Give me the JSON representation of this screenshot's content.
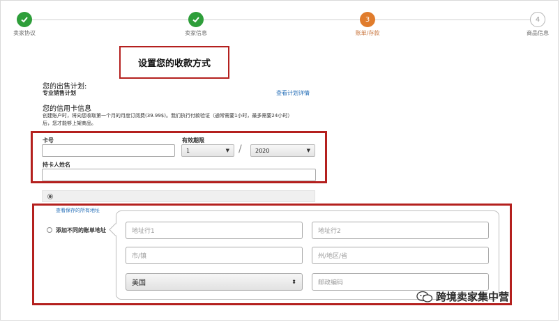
{
  "stepper": {
    "steps": [
      {
        "label": "卖家协议",
        "state": "done"
      },
      {
        "label": "卖家信息",
        "state": "done"
      },
      {
        "label": "账单/存款",
        "state": "current",
        "number": "3"
      },
      {
        "label": "商品信息",
        "state": "todo",
        "number": "4"
      }
    ],
    "colors": {
      "done": "#2e9e3a",
      "current": "#e07c2c",
      "todo": "#b5b5b5"
    }
  },
  "title": "设置您的收款方式",
  "plan": {
    "heading": "您的出售计划:",
    "name": "专业销售计划",
    "details_link": "查看计划详情"
  },
  "credit_card": {
    "heading": "您的信用卡信息",
    "note_line1": "创建账户时，将向您收取第一个月的月度订阅费(39.99$)。我们执行付款验证（通常需要1小时，最多需要24小时）",
    "note_line2": "后，您才能够上架商品。",
    "card_number_label": "卡号",
    "card_number_value": "",
    "expiry_label": "有效期限",
    "expiry_month": "1",
    "expiry_separator": "/",
    "expiry_year": "2020",
    "cardholder_label": "持卡人姓名",
    "cardholder_value": ""
  },
  "billing": {
    "saved_address_link": "查看保存的所有地址",
    "add_address_label": "添加不同的账单地址",
    "fields": {
      "address1_placeholder": "地址行1",
      "address2_placeholder": "地址行2",
      "city_placeholder": "市/镇",
      "state_placeholder": "州/地区/省",
      "country_value": "美国",
      "zip_placeholder": "邮政编码"
    }
  },
  "watermark": "跨境卖家集中营",
  "accent": {
    "highlight_red": "#b4201e",
    "link_blue": "#2870b8"
  }
}
